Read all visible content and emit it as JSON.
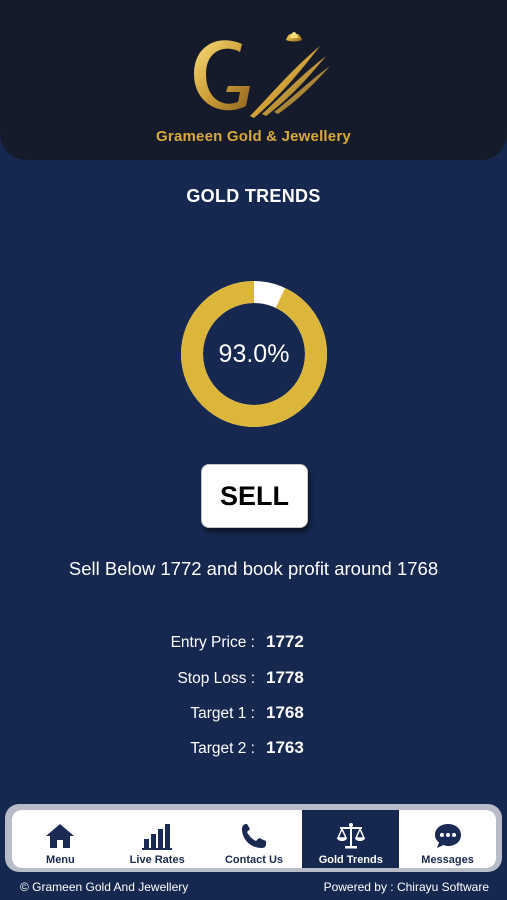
{
  "header": {
    "brand_name": "Grameen Gold & Jewellery",
    "logo_icon": "gold-g-logo-icon"
  },
  "page": {
    "title": "GOLD TRENDS"
  },
  "trend": {
    "percentage_label": "93.0%",
    "percentage_value": 93.0,
    "signal": "SELL",
    "advice": "Sell Below 1772 and book profit around 1768",
    "ring_color": "#dcb63a",
    "ring_remainder_color": "#ffffff"
  },
  "stats": [
    {
      "label": "Entry Price :",
      "value": "1772"
    },
    {
      "label": "Stop Loss :",
      "value": "1778"
    },
    {
      "label": "Target 1 :",
      "value": "1768"
    },
    {
      "label": "Target 2 :",
      "value": "1763"
    }
  ],
  "nav": {
    "items": [
      {
        "label": "Menu",
        "icon": "home-icon",
        "active": false
      },
      {
        "label": "Live Rates",
        "icon": "bar-chart-icon",
        "active": false
      },
      {
        "label": "Contact Us",
        "icon": "phone-icon",
        "active": false
      },
      {
        "label": "Gold Trends",
        "icon": "scale-icon",
        "active": true
      },
      {
        "label": "Messages",
        "icon": "chat-icon",
        "active": false
      }
    ]
  },
  "footer": {
    "copyright": "© Grameen Gold And Jewellery",
    "powered_by": "Powered by : Chirayu Software"
  },
  "colors": {
    "background": "#16284f",
    "header": "#161b2c",
    "gold": "#d9a93a"
  }
}
